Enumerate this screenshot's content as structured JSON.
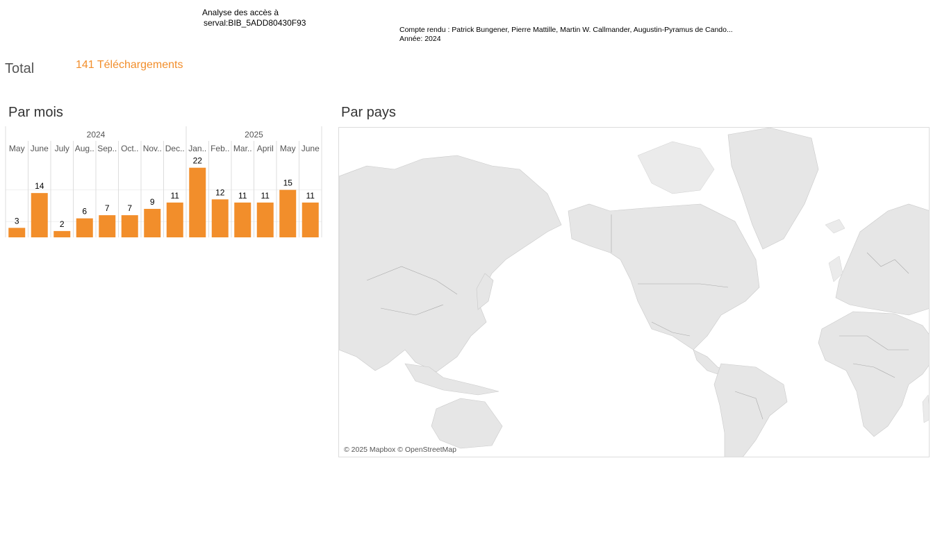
{
  "header": {
    "title_line1": "Analyse des accès à",
    "title_line2": "serval:BIB_5ADD80430F93",
    "report_line": "Compte rendu : Patrick Bungener, Pierre Mattille, Martin W. Callmander, Augustin-Pyramus de Cando...",
    "year_line": "Année: 2024"
  },
  "total": {
    "label": "Total",
    "value": "141 Téléchargements"
  },
  "sections": {
    "months_title": "Par mois",
    "country_title": "Par pays"
  },
  "map": {
    "attribution": "© 2025 Mapbox © OpenStreetMap"
  },
  "colors": {
    "bar": "#F28E2B",
    "total": "#F28E2B"
  },
  "chart_data": {
    "type": "bar",
    "years": [
      {
        "label": "2024",
        "span": 8
      },
      {
        "label": "2025",
        "span": 6
      }
    ],
    "categories": [
      "May",
      "June",
      "July",
      "Aug..",
      "Sep..",
      "Oct..",
      "Nov..",
      "Dec..",
      "Jan..",
      "Feb..",
      "Mar..",
      "April",
      "May",
      "June"
    ],
    "values": [
      3,
      14,
      2,
      6,
      7,
      7,
      9,
      11,
      22,
      12,
      11,
      11,
      15,
      11
    ],
    "title": "Par mois",
    "xlabel": "",
    "ylabel": "",
    "ylim": [
      0,
      25
    ],
    "grid": true
  }
}
